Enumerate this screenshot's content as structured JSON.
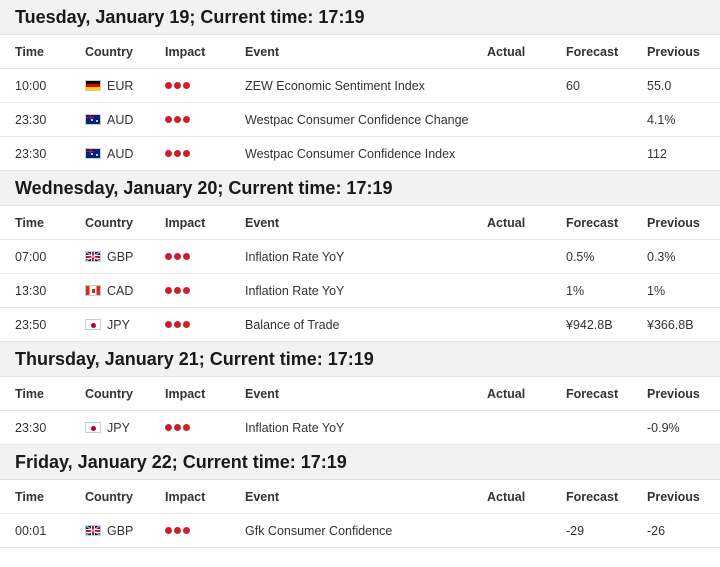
{
  "columns": {
    "time": "Time",
    "country": "Country",
    "impact": "Impact",
    "event": "Event",
    "actual": "Actual",
    "forecast": "Forecast",
    "previous": "Previous"
  },
  "colors": {
    "impact_dot": "#cc1f2e",
    "header_bg": "#f2f2f2"
  },
  "days": [
    {
      "title": "Tuesday, January 19; Current time: 17:19",
      "rows": [
        {
          "time": "10:00",
          "flag": "eur-flag-icon",
          "country": "EUR",
          "impact_level": 3,
          "event": "ZEW Economic Sentiment Index",
          "actual": "",
          "forecast": "60",
          "previous": "55.0"
        },
        {
          "time": "23:30",
          "flag": "aud-flag-icon",
          "country": "AUD",
          "impact_level": 3,
          "event": "Westpac Consumer Confidence Change",
          "actual": "",
          "forecast": "",
          "previous": "4.1%"
        },
        {
          "time": "23:30",
          "flag": "aud-flag-icon",
          "country": "AUD",
          "impact_level": 3,
          "event": "Westpac Consumer Confidence Index",
          "actual": "",
          "forecast": "",
          "previous": "112"
        }
      ]
    },
    {
      "title": "Wednesday, January 20; Current time: 17:19",
      "rows": [
        {
          "time": "07:00",
          "flag": "gbp-flag-icon",
          "country": "GBP",
          "impact_level": 3,
          "event": "Inflation Rate YoY",
          "actual": "",
          "forecast": "0.5%",
          "previous": "0.3%"
        },
        {
          "time": "13:30",
          "flag": "cad-flag-icon",
          "country": "CAD",
          "impact_level": 3,
          "event": "Inflation Rate YoY",
          "actual": "",
          "forecast": "1%",
          "previous": "1%"
        },
        {
          "time": "23:50",
          "flag": "jpy-flag-icon",
          "country": "JPY",
          "impact_level": 3,
          "event": "Balance of Trade",
          "actual": "",
          "forecast": "¥942.8B",
          "previous": "¥366.8B"
        }
      ]
    },
    {
      "title": "Thursday, January 21; Current time: 17:19",
      "rows": [
        {
          "time": "23:30",
          "flag": "jpy-flag-icon",
          "country": "JPY",
          "impact_level": 3,
          "event": "Inflation Rate YoY",
          "actual": "",
          "forecast": "",
          "previous": "-0.9%"
        }
      ]
    },
    {
      "title": "Friday, January 22; Current time: 17:19",
      "rows": [
        {
          "time": "00:01",
          "flag": "gbp-flag-icon",
          "country": "GBP",
          "impact_level": 3,
          "event": "Gfk Consumer Confidence",
          "actual": "",
          "forecast": "-29",
          "previous": "-26"
        }
      ]
    }
  ]
}
